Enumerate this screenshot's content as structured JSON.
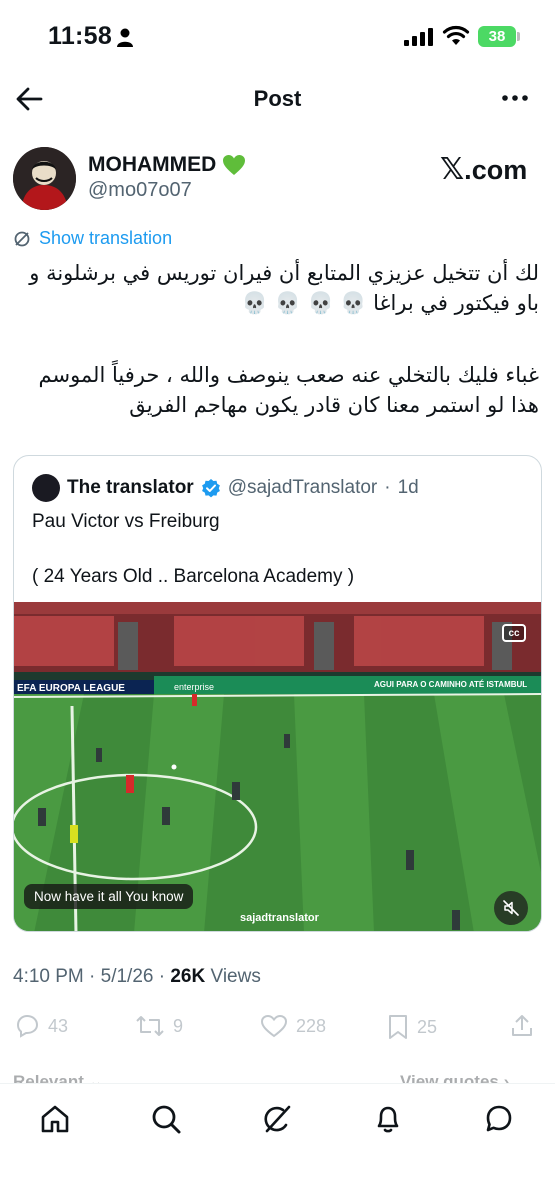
{
  "status_bar": {
    "time": "11:58",
    "battery": "38"
  },
  "header": {
    "title": "Post"
  },
  "author": {
    "name": "MOHAMMED",
    "handle": "@mo07o07",
    "brand": "com",
    "brand_x": "𝕏"
  },
  "translate_label": "Show translation",
  "post_text": {
    "line1": "لك أن تتخيل عزيزي المتابع أن فيران توريس في برشلونة و",
    "line2": "باو فيكتور في براغا 💀 💀 💀 💀",
    "line3": "غباء فليك بالتخلي عنه صعب ينوصف والله ، حرفياً الموسم",
    "line4": "هذا لو استمر معنا كان قادر يكون مهاجم الفريق"
  },
  "quote": {
    "name": "The translator",
    "handle": "@sajadTranslator",
    "sep": "·",
    "age": "1d",
    "line1": "Pau Victor vs Freiburg",
    "line2": "( 24 Years Old .. Barcelona Academy )",
    "video": {
      "banner_left": "EFA EUROPA LEAGUE",
      "banner_mid": "enterprise",
      "banner_right": "AGUI PARA O CAMINHO ATÉ ISTAMBUL",
      "cc": "cc",
      "subtitle": "Now have it all You know",
      "watermark": "sajadtranslator"
    }
  },
  "meta": {
    "time": "4:10 PM · 5/1/26 · ",
    "views_count": "26K",
    "views_label": " Views"
  },
  "actions": {
    "replies": "43",
    "reposts": "9",
    "likes": "228",
    "bookmarks": "25"
  },
  "sort_label": "Relevant ⌄",
  "view_quotes": "View quotes ›",
  "colors": {
    "accent": "#1d9bf0",
    "verified": "#1d9bf0",
    "battery": "#4cd964",
    "pitch": "#3f8a3a"
  },
  "icons": [
    "back-arrow-icon",
    "more-icon",
    "green-heart-icon",
    "translate-icon",
    "verified-badge-icon",
    "mute-icon",
    "home-icon",
    "search-icon",
    "grok-icon",
    "bell-icon",
    "messages-icon"
  ]
}
